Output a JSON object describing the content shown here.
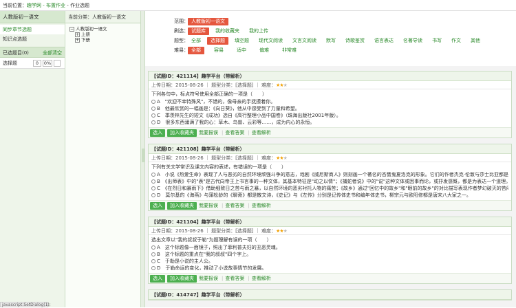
{
  "breadcrumb": {
    "prefix": "当前位置：",
    "link": "趣学网 - 布置作业",
    "suffix": " - 作业选题"
  },
  "left": {
    "title": "人教版初一语文",
    "nav": [
      "同步章节选题",
      "知识点选题"
    ],
    "selected_header": "已选题目(0)",
    "clear_label": "全部清空",
    "sel_row": {
      "type": "选择题",
      "count": "0",
      "pct": "0%"
    }
  },
  "tree": {
    "header": "当前分类：人教版初一语文",
    "root": "人教版初一语文",
    "children": [
      "上册",
      "下册"
    ]
  },
  "filters": {
    "scope_label": "范围：",
    "scope_value": "人教版初一语文",
    "brush_label": "刷选：",
    "brush_items": [
      "试题库",
      "我的收藏夹",
      "我的上传"
    ],
    "type_label": "题型：",
    "type_items": [
      "全部",
      "选择题",
      "填空题",
      "现代文阅读",
      "文言文阅读",
      "默写",
      "诗歌鉴赏",
      "语言表达",
      "名著导读",
      "书写",
      "作文",
      "其他"
    ],
    "diff_label": "难易：",
    "diff_items": [
      "全部",
      "容易",
      "适中",
      "偏难",
      "非常难"
    ]
  },
  "questions": [
    {
      "head": "【试题ID：421114】趣学平台（带解析）",
      "meta_prefix": "上传日期：2015-08-26 ｜ 题型分类：[选择题] ｜ 难度：",
      "stars_on": "★★",
      "stars_off": "★",
      "stem": "下列各句中，标点符号使用全部正确的一项是（　　）",
      "options": [
        "A　\"欢迎不幸特殊风\"，不错的，像母亲的手抚摸着你。",
        "B　他最欣赏的一幅画是：《向日葵》，他从中感受到了力量和希望。",
        "C　季羡林先生的短文《成功》选自《高行整理小品中国卷》（珠海出版社2001年版）。",
        "D　很多东西涌满了我的心：草木、鸟兽、云彩等……，成为内心的永恒。"
      ],
      "btn_add": "选入",
      "btn_fav": "加入收藏夹",
      "links": [
        "我要报误",
        "查看答案",
        "查看解析"
      ]
    },
    {
      "head": "【试题ID：421108】趣学平台（带解析）",
      "meta_prefix": "上传日期：2015-08-26 ｜ 题型分类：[选择题] ｜ 难度：",
      "stars_on": "★★",
      "stars_off": "★",
      "stem": "下列有关文学常识及课文内容的表述，有错误的一项是（　　）",
      "options": [
        "A　小说《热爱生命》表现了人与恶劣的自然环境顽强斗争的意志，戏剧《威尼斯商人》则刻画一个著名的吝啬鬼夏洛克的形象。它们的作者杰克·伦敦与莎士比亚都是英国人。",
        "B　《出师表》中的\"表\"是古代向帝王上书言事的一种文体，其基本特征是\"动之以情\"；《捕蛇者说》中的\"说\"这种文体或因事而论，或抒发感慨，都是为表达一个道理。",
        "C　《在烈日和暴雨下》借助细致日之苦与雨之暴，以自然环境的恶劣衬托人物的痛苦；《故乡》通过\"回忆中的故乡\"和\"眼前的故乡\"的对比描写表现作者梦幻破灭的苦闷心情。",
        "D　莫尔基的《海燕》与蒲松龄的《聊斋》都是散文诗，《史记》与《左传》分别是记传体史书和编年体史书，柳宗元与欧阳修都是唐宋八大家之一。"
      ],
      "btn_add": "选入",
      "btn_fav": "加入收藏夹",
      "links": [
        "我要报误",
        "查看答案",
        "查看解析"
      ]
    },
    {
      "head": "【试题ID：421104】趣学平台（带解析）",
      "meta_prefix": "上传日期：2015-08-26 ｜ 题型分类：[选择题] ｜ 难度：",
      "stars_on": "★★",
      "stars_off": "★",
      "stem": "选出文章以\"我的叔叔于勒\"为题理解有误的一项（　　）",
      "options": [
        "A　这个标题像一面镜子，照出了菲利普夫妇的丑恶灵魂。",
        "B　这个标题的重点在\"我的叔叔\"四个字上。",
        "C　于勒是小说的主人公。",
        "D　于勒命运的变化，推动了小说故事情节的发展。"
      ],
      "btn_add": "选入",
      "btn_fav": "加入收藏夹",
      "links": [
        "我要报误",
        "查看答案",
        "查看解析"
      ]
    },
    {
      "head": "【试题ID：414747】趣学平台（带解析）"
    }
  ],
  "status_text": "javascript:SetDialog(1);"
}
